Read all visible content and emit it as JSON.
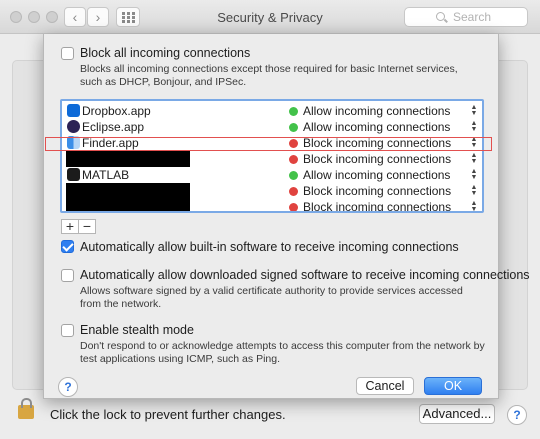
{
  "window": {
    "title": "Security & Privacy",
    "search_placeholder": "Search",
    "nav_back": "‹",
    "nav_forward": "›"
  },
  "sheet": {
    "block_all": {
      "label": "Block all incoming connections",
      "checked": false,
      "description": "Blocks all incoming connections except those required for basic Internet services,  such as DHCP, Bonjour, and IPSec."
    },
    "apps": [
      {
        "name": "Dropbox.app",
        "status": "Allow incoming connections",
        "status_color": "#43c24a",
        "icon": "dropbox-icon",
        "redacted": false
      },
      {
        "name": "Eclipse.app",
        "status": "Allow incoming connections",
        "status_color": "#43c24a",
        "icon": "eclipse-icon",
        "redacted": false
      },
      {
        "name": "Finder.app",
        "status": "Block incoming connections",
        "status_color": "#e0433f",
        "icon": "finder-icon",
        "redacted": false
      },
      {
        "name": "",
        "status": "Block incoming connections",
        "status_color": "#e0433f",
        "icon": "",
        "redacted": true
      },
      {
        "name": "MATLAB",
        "status": "Allow incoming connections",
        "status_color": "#43c24a",
        "icon": "matlab-icon",
        "redacted": false
      },
      {
        "name": "",
        "status": "Block incoming connections",
        "status_color": "#e0433f",
        "icon": "",
        "redacted": true
      },
      {
        "name": "",
        "status": "Block incoming connections",
        "status_color": "#e0433f",
        "icon": "",
        "redacted": true
      }
    ],
    "add_label": "+",
    "remove_label": "−",
    "auto_builtin": {
      "label": "Automatically allow built-in software to receive incoming connections",
      "checked": true
    },
    "auto_signed": {
      "label": "Automatically allow downloaded signed software to receive incoming connections",
      "checked": false,
      "description": "Allows software signed by a valid certificate authority to provide services accessed from the network."
    },
    "stealth": {
      "label": "Enable stealth mode",
      "checked": false,
      "description": "Don't respond to or acknowledge attempts to access this computer from the network by test applications using ICMP, such as Ping."
    },
    "help_label": "?",
    "cancel_label": "Cancel",
    "ok_label": "OK"
  },
  "footer": {
    "lock_text": "Click the lock to prevent further changes.",
    "advanced_label": "Advanced...",
    "help_label": "?"
  },
  "colors": {
    "accent": "#2f7ff0",
    "allow": "#43c24a",
    "block": "#e0433f",
    "highlight_annotation": "#e2504f"
  }
}
